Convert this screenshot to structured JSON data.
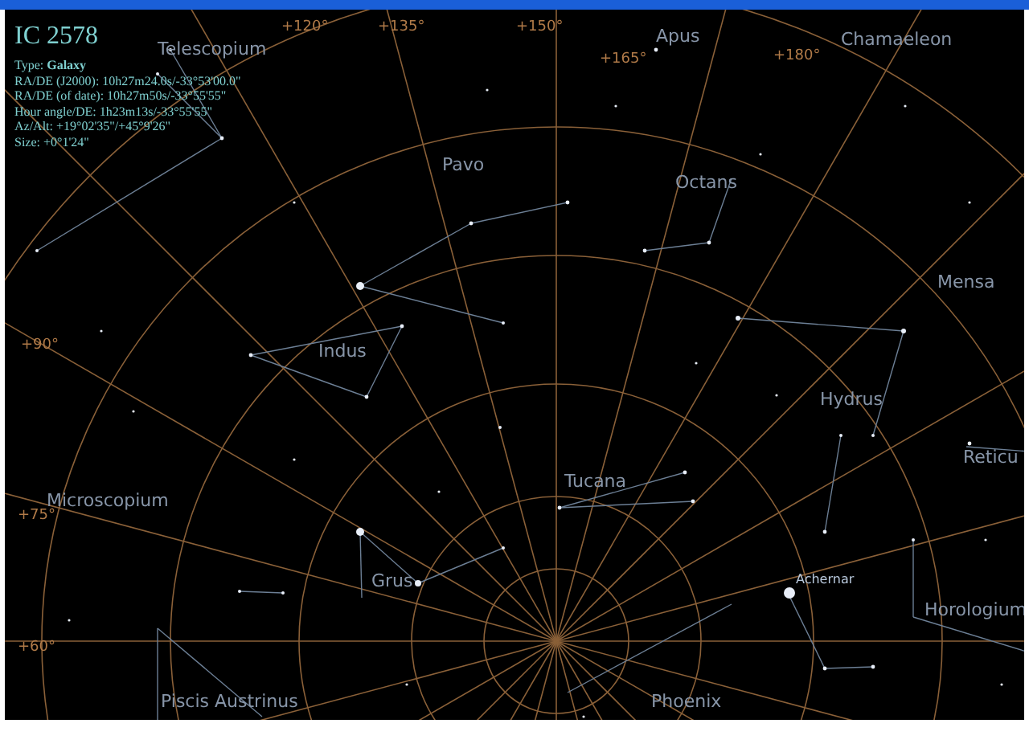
{
  "selected_object": {
    "name": "IC 2578",
    "info": [
      "Type: **Galaxy**",
      "RA/DE (J2000): 10h27m24.0s/-33°53'00.0\"",
      "RA/DE (of date): 10h27m50s/-33°55'55\"",
      "Hour angle/DE: 1h23m13s/-33°55'55\"",
      "Az/Alt: +19°02'35\"/+45°9'26\"",
      "Size: +0°1'24\""
    ]
  },
  "sky_labels": [
    {
      "kind": "constellation",
      "text": "Telescopium"
    },
    {
      "kind": "constellation",
      "text": "Apus"
    },
    {
      "kind": "constellation",
      "text": "Chamaeleon"
    },
    {
      "kind": "constellation",
      "text": "Pavo"
    },
    {
      "kind": "constellation",
      "text": "Octans"
    },
    {
      "kind": "constellation",
      "text": "Mensa"
    },
    {
      "kind": "constellation",
      "text": "Indus"
    },
    {
      "kind": "constellation",
      "text": "Hydrus"
    },
    {
      "kind": "constellation",
      "text": "Reticu"
    },
    {
      "kind": "constellation",
      "text": "Microscopium"
    },
    {
      "kind": "constellation",
      "text": "Tucana"
    },
    {
      "kind": "constellation",
      "text": "Grus"
    },
    {
      "kind": "star",
      "text": "Achernar"
    },
    {
      "kind": "constellation",
      "text": "Horologium"
    },
    {
      "kind": "constellation",
      "text": "Piscis Austrinus"
    },
    {
      "kind": "constellation",
      "text": "Phoenix"
    }
  ],
  "grid_labels": [
    "+120°",
    "+135°",
    "+150°",
    "+165°",
    "+180°",
    "+90°",
    "+75°",
    "+60°"
  ]
}
